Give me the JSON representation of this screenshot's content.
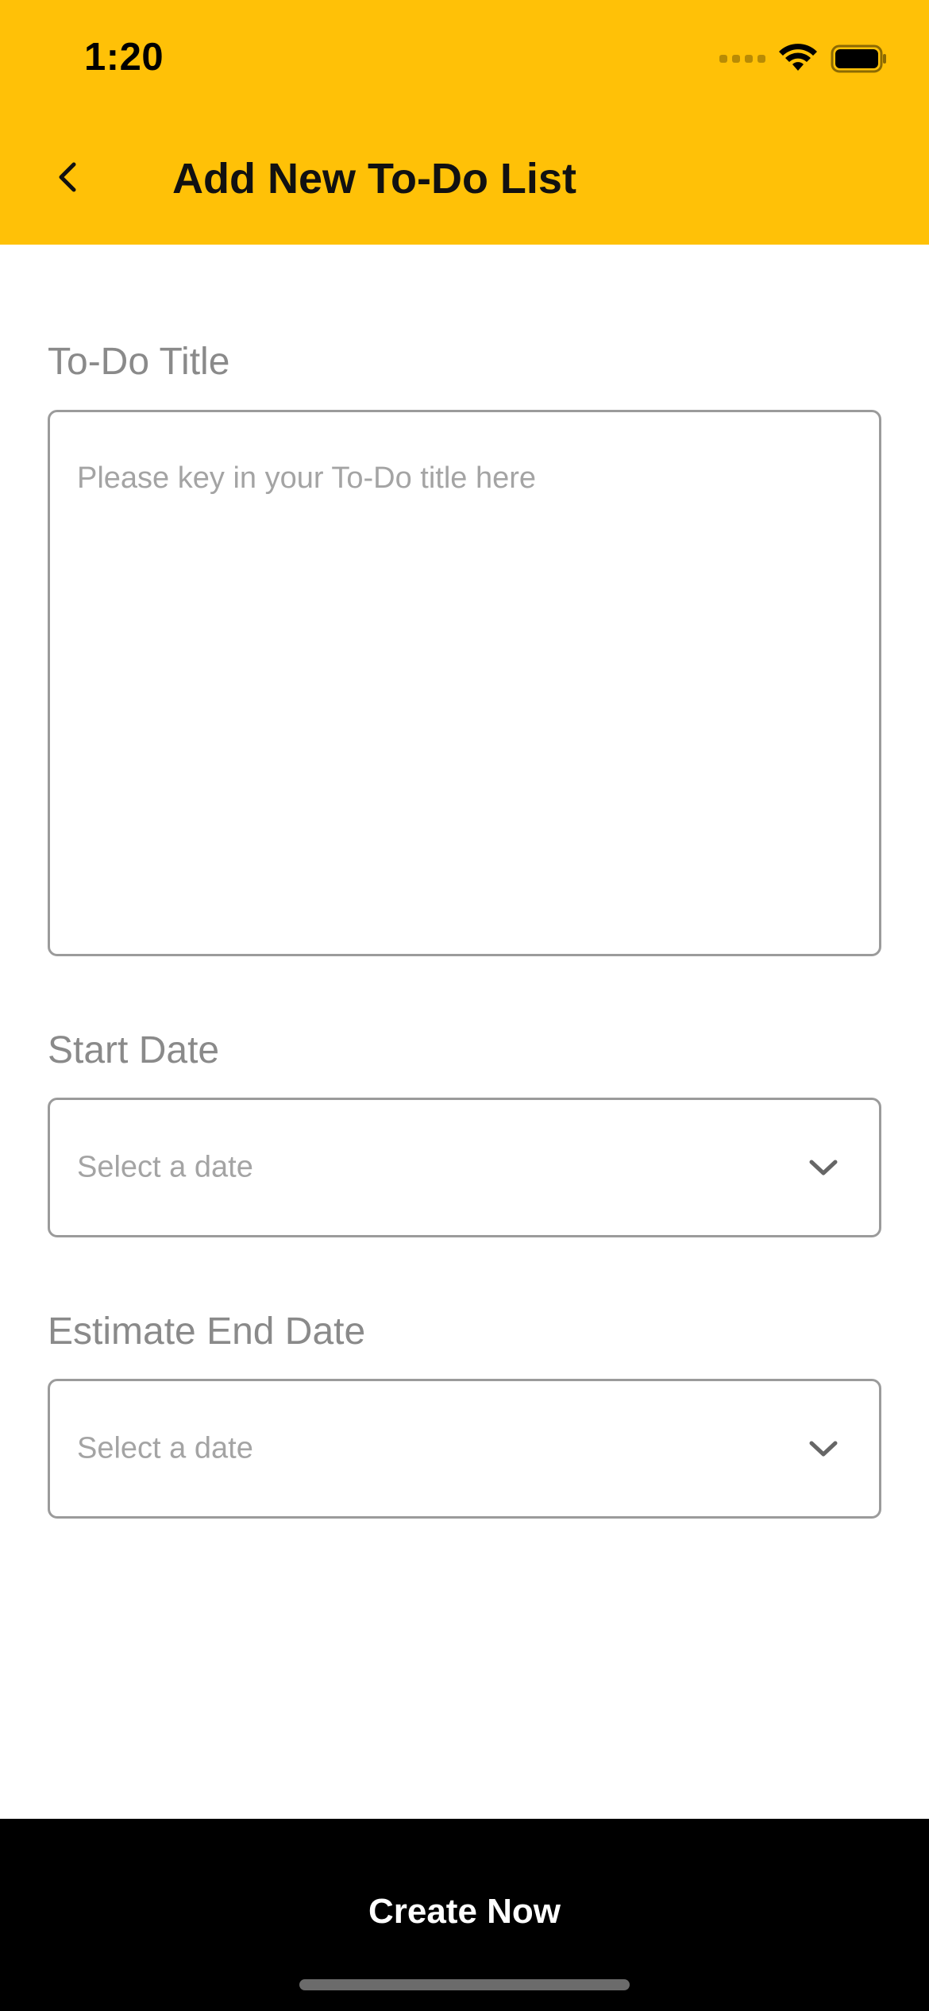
{
  "status_bar": {
    "time": "1:20",
    "icons": [
      "signal-icon",
      "wifi-icon",
      "battery-icon"
    ]
  },
  "header": {
    "title": "Add New To-Do List",
    "back_icon": "chevron-left-icon",
    "background_color": "#FFC107"
  },
  "form": {
    "title_field": {
      "label": "To-Do Title",
      "placeholder": "Please key in your To-Do title here",
      "value": ""
    },
    "start_date": {
      "label": "Start Date",
      "placeholder": "Select a date",
      "icon": "chevron-down-icon"
    },
    "end_date": {
      "label": "Estimate End Date",
      "placeholder": "Select a date",
      "icon": "chevron-down-icon"
    }
  },
  "footer": {
    "create_label": "Create Now",
    "background_color": "#000000"
  }
}
